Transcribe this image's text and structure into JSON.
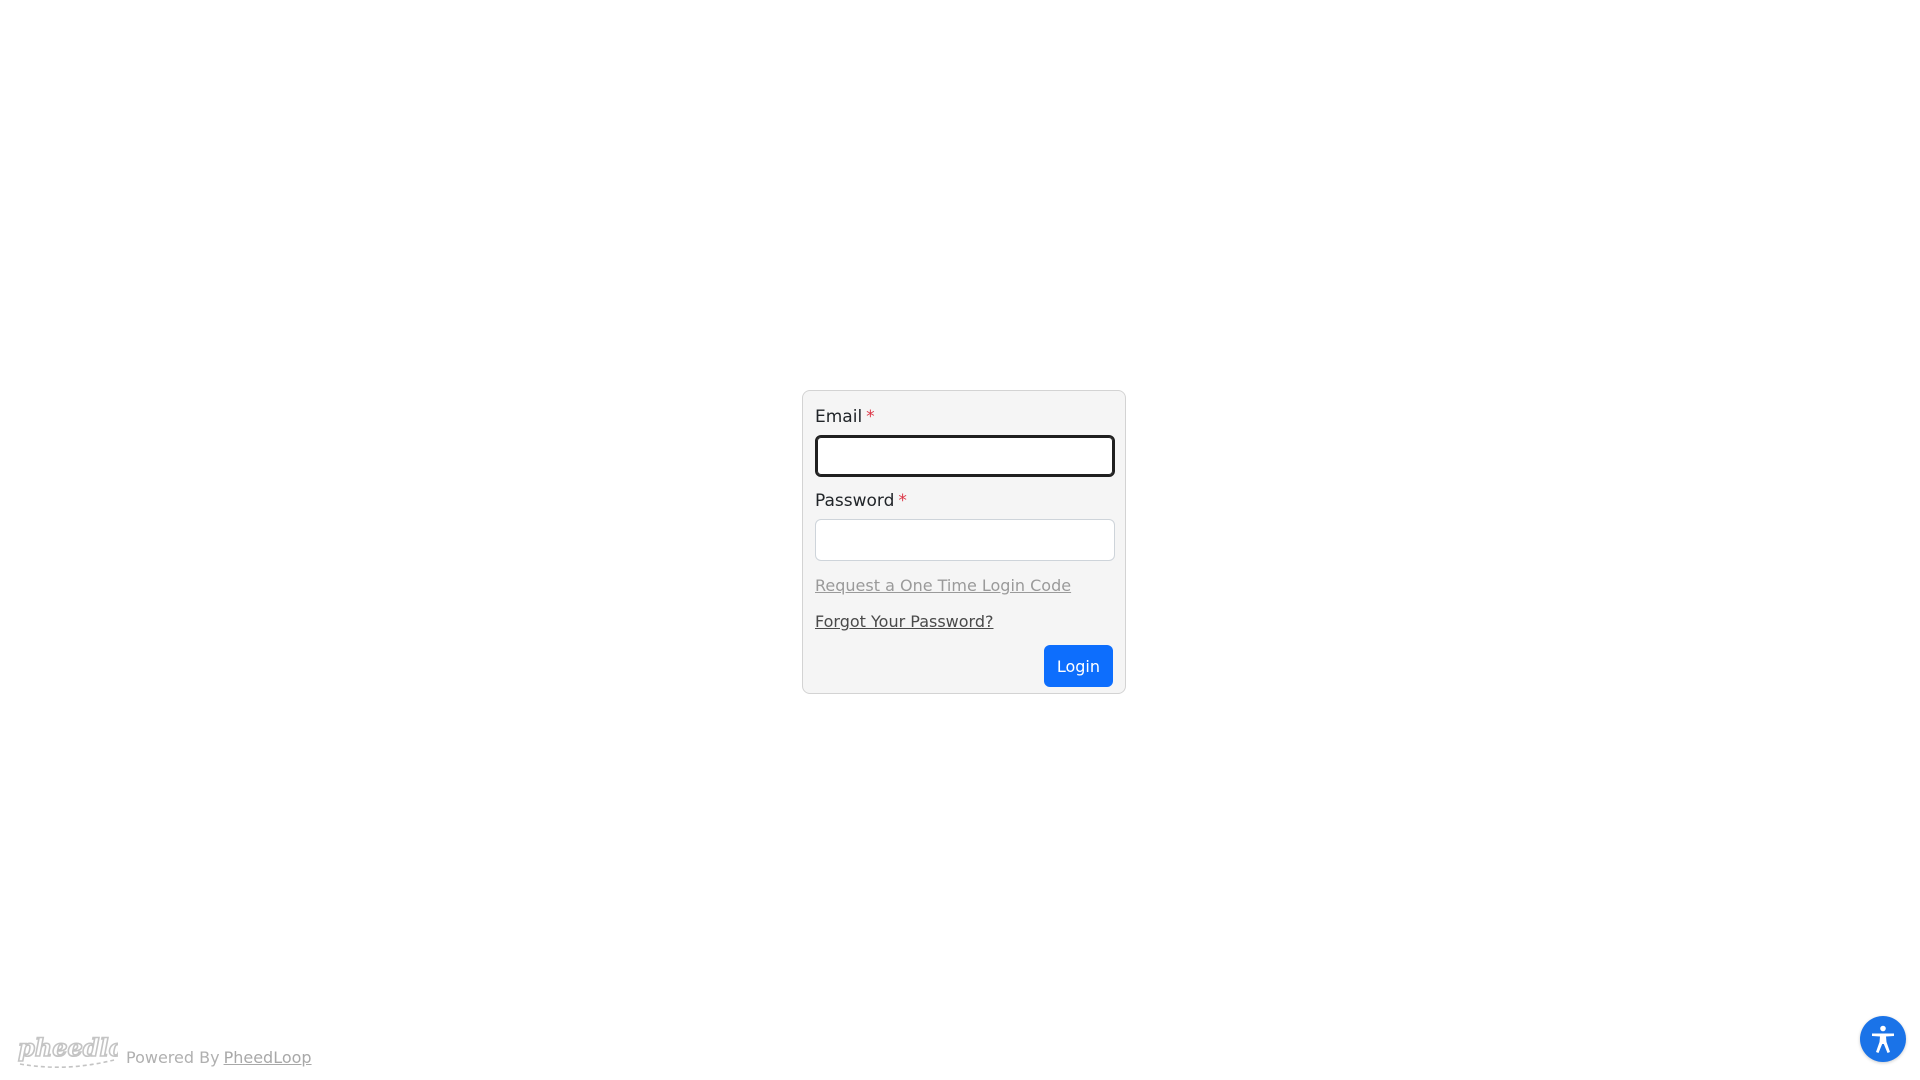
{
  "form": {
    "email_label": "Email",
    "email_required": "*",
    "email_value": "",
    "password_label": "Password",
    "password_required": "*",
    "password_value": "",
    "one_time_code_link": "Request a One Time Login Code",
    "forgot_password_link": "Forgot Your Password?",
    "login_button": "Login"
  },
  "footer": {
    "logo_alt": "pheedloop",
    "powered_by_text": "Powered By",
    "powered_by_link": "PheedLoop"
  },
  "accessibility": {
    "icon": "accessibility-icon"
  },
  "colors": {
    "primary": "#0d6efd",
    "required": "#dc3545",
    "card_bg": "#f5f5f5",
    "accessibility_bg": "#1a73e8"
  }
}
